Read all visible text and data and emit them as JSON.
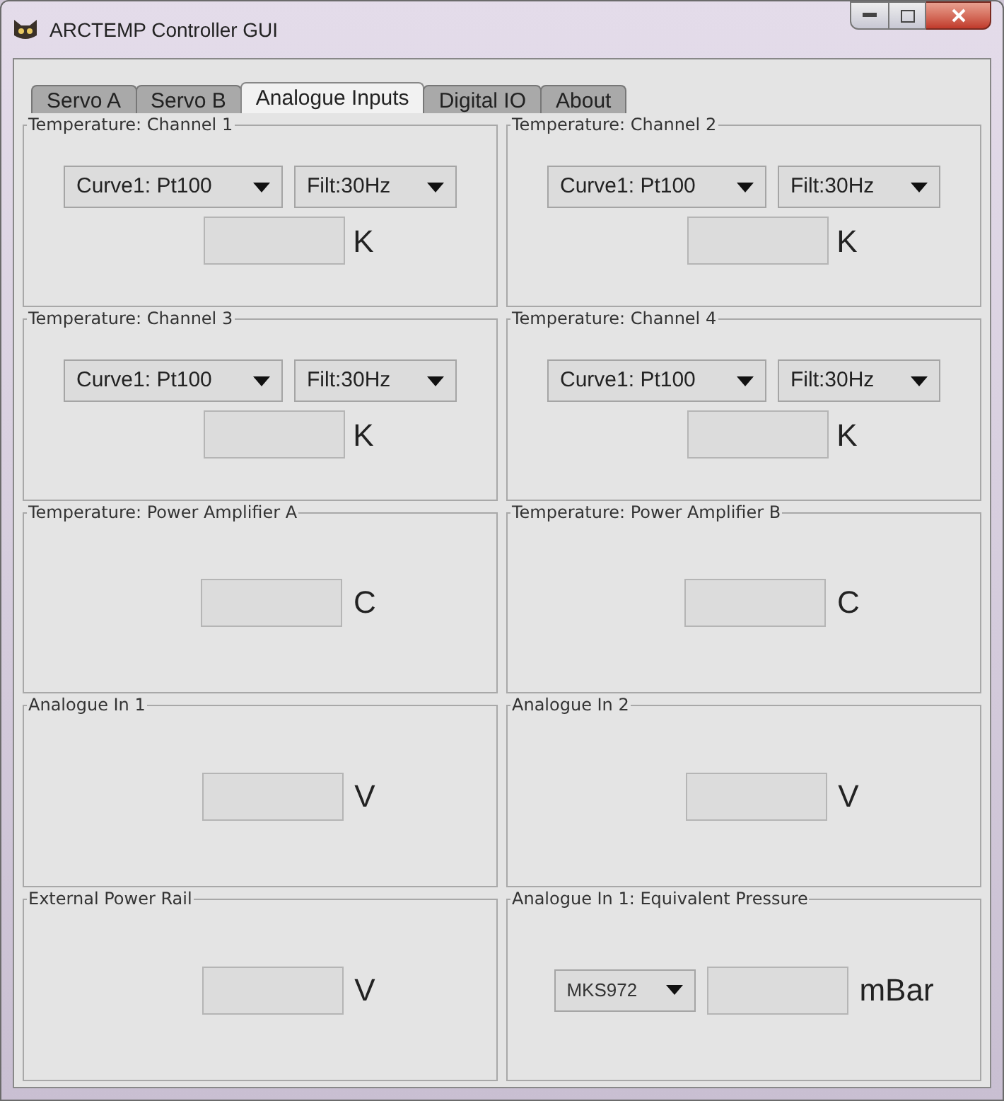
{
  "window": {
    "title": "ARCTEMP Controller GUI"
  },
  "tabs": [
    {
      "label": "Servo A",
      "selected": false
    },
    {
      "label": "Servo B",
      "selected": false
    },
    {
      "label": "Analogue Inputs",
      "selected": true
    },
    {
      "label": "Digital IO",
      "selected": false
    },
    {
      "label": "About",
      "selected": false
    }
  ],
  "panels": [
    {
      "title": "Temperature: Channel 1",
      "kind": "channel",
      "dropdowns": [
        "Curve1: Pt100",
        "Filt:30Hz"
      ],
      "unit": "K"
    },
    {
      "title": "Temperature: Channel 2",
      "kind": "channel",
      "dropdowns": [
        "Curve1: Pt100",
        "Filt:30Hz"
      ],
      "unit": "K"
    },
    {
      "title": "Temperature: Channel 3",
      "kind": "channel",
      "dropdowns": [
        "Curve1: Pt100",
        "Filt:30Hz"
      ],
      "unit": "K"
    },
    {
      "title": "Temperature: Channel 4",
      "kind": "channel",
      "dropdowns": [
        "Curve1: Pt100",
        "Filt:30Hz"
      ],
      "unit": "K"
    },
    {
      "title": "Temperature: Power Amplifier A",
      "kind": "reading",
      "unit": "C"
    },
    {
      "title": "Temperature: Power Amplifier B",
      "kind": "reading",
      "unit": "C"
    },
    {
      "title": "Analogue In 1",
      "kind": "reading",
      "unit": "V"
    },
    {
      "title": "Analogue In 2",
      "kind": "reading",
      "unit": "V"
    },
    {
      "title": "External Power Rail",
      "kind": "reading",
      "unit": "V"
    },
    {
      "title": "Analogue In 1: Equivalent Pressure",
      "kind": "pressure",
      "dropdowns": [
        "MKS972"
      ],
      "unit": "mBar"
    }
  ]
}
